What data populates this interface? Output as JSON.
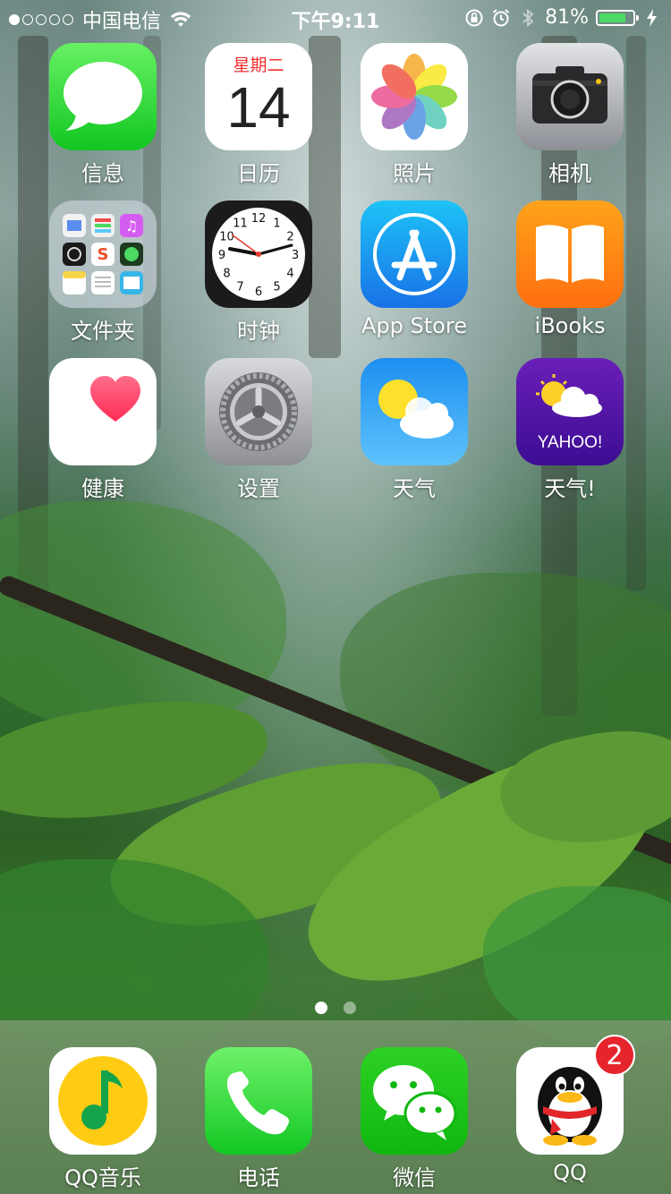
{
  "status_bar": {
    "carrier": "中国电信",
    "time": "下午9:11",
    "battery_percent": "81%",
    "battery_level": 0.81,
    "signal_dots_filled": 1,
    "signal_dots_total": 5
  },
  "apps": [
    {
      "label": "信息",
      "icon": "messages-icon"
    },
    {
      "label": "日历",
      "icon": "calendar-icon",
      "weekday": "星期二",
      "day": "14"
    },
    {
      "label": "照片",
      "icon": "photos-icon"
    },
    {
      "label": "相机",
      "icon": "camera-icon"
    },
    {
      "label": "文件夹",
      "icon": "folder-icon"
    },
    {
      "label": "时钟",
      "icon": "clock-icon"
    },
    {
      "label": "App Store",
      "icon": "app-store-icon"
    },
    {
      "label": "iBooks",
      "icon": "ibooks-icon"
    },
    {
      "label": "健康",
      "icon": "health-icon"
    },
    {
      "label": "设置",
      "icon": "settings-icon"
    },
    {
      "label": "天气",
      "icon": "weather-icon"
    },
    {
      "label": "天气!",
      "icon": "yahoo-weather-icon",
      "logo_text": "YAHOO!"
    }
  ],
  "clock": {
    "numbers": [
      "12",
      "1",
      "2",
      "3",
      "4",
      "5",
      "6",
      "7",
      "8",
      "9",
      "10",
      "11"
    ]
  },
  "page_indicator": {
    "pages": 2,
    "active": 1
  },
  "dock": [
    {
      "label": "QQ音乐",
      "icon": "qq-music-icon"
    },
    {
      "label": "电话",
      "icon": "phone-icon"
    },
    {
      "label": "微信",
      "icon": "wechat-icon"
    },
    {
      "label": "QQ",
      "icon": "qq-icon",
      "badge": "2"
    }
  ],
  "colors": {
    "battery_green": "#4cd964",
    "badge_red": "#e6242b"
  }
}
